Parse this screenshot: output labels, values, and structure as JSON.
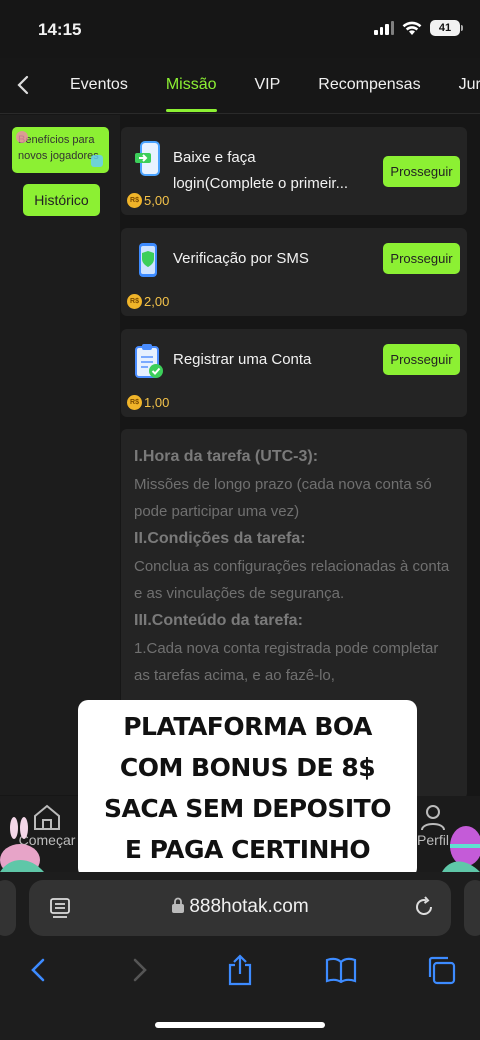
{
  "status": {
    "time": "14:15",
    "battery": "41"
  },
  "nav": {
    "tabs": [
      {
        "label": "Eventos"
      },
      {
        "label": "Missão"
      },
      {
        "label": "VIP"
      },
      {
        "label": "Recompensas"
      },
      {
        "label": "Jur"
      }
    ],
    "active_tab": "Missão"
  },
  "sidebar": {
    "card_label": "Benefícios para novos jogadores",
    "history_label": "Histórico"
  },
  "tasks": [
    {
      "title_line1": "Baixe e faça",
      "title_line2": "login(Complete o primeir...",
      "button": "Prosseguir",
      "currency": "R$",
      "reward": "5,00",
      "icon": "phone-download-icon"
    },
    {
      "title_line1": "Verificação por SMS",
      "button": "Prosseguir",
      "currency": "R$",
      "reward": "2,00",
      "icon": "phone-shield-icon"
    },
    {
      "title_line1": "Registrar uma Conta",
      "button": "Prosseguir",
      "currency": "R$",
      "reward": "1,00",
      "icon": "clipboard-check-icon"
    }
  ],
  "rules": {
    "h1": "I.Hora da tarefa (UTC-3):",
    "p1": "Missões de longo prazo (cada nova conta só pode participar uma vez)",
    "h2": "II.Condições da tarefa:",
    "p2": "Conclua as configurações relacionadas à conta e as vinculações de segurança.",
    "h3": "III.Conteúdo da tarefa:",
    "p3": "1.Cada nova conta registrada pode completar as tarefas acima, e ao fazê-lo,"
  },
  "bottom_nav": {
    "left_label": "Começar",
    "right_label": "Perfil"
  },
  "overlay_text": [
    "PLATAFORMA BOA",
    "COM BONUS DE 8$",
    "SACA SEM DEPOSITO",
    "E PAGA CERTINHO"
  ],
  "browser": {
    "url": "888hotak.com"
  },
  "colors": {
    "accent": "#8cf033",
    "background": "#161616",
    "card": "#242424",
    "reward": "#f3c24a"
  }
}
